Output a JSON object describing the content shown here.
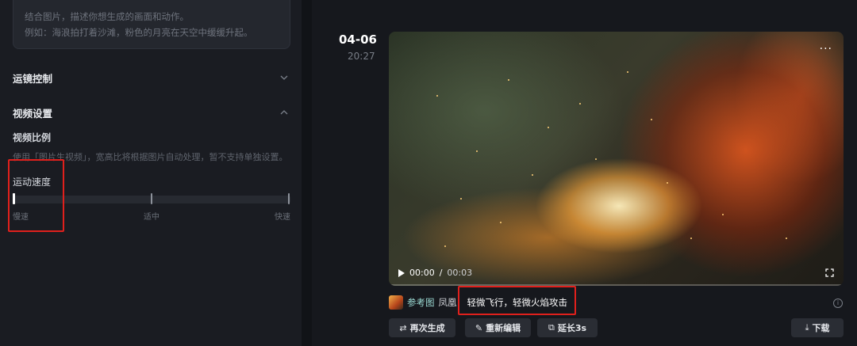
{
  "left_panel": {
    "prompt": {
      "line1": "结合图片，描述你想生成的画面和动作。",
      "line2": "例如：海浪拍打着沙滩，粉色的月亮在天空中缓缓升起。"
    },
    "camera_control": {
      "label": "运镜控制"
    },
    "video_settings": {
      "label": "视频设置",
      "ratio_label": "视频比例",
      "ratio_hint": "使用「图片生视频」，宽高比将根据图片自动处理，暂不支持单独设置。",
      "speed_label": "运动速度",
      "speed_options": [
        "慢速",
        "适中",
        "快速"
      ],
      "speed_selected": "慢速"
    }
  },
  "result": {
    "date": "04-06",
    "time": "20:27",
    "video": {
      "current_time": "00:00",
      "separator": "/",
      "duration": "00:03",
      "progress": 0
    },
    "ref_label": "参考图",
    "subject": "凤凰",
    "description": "轻微飞行，轻微火焰攻击",
    "actions": {
      "regenerate": "再次生成",
      "reedit": "重新编辑",
      "extend": "延长3s",
      "download": "下载"
    }
  },
  "colors": {
    "highlight_box": "#e0201c",
    "panel_bg": "#1a1c22",
    "page_bg": "#16181d"
  }
}
